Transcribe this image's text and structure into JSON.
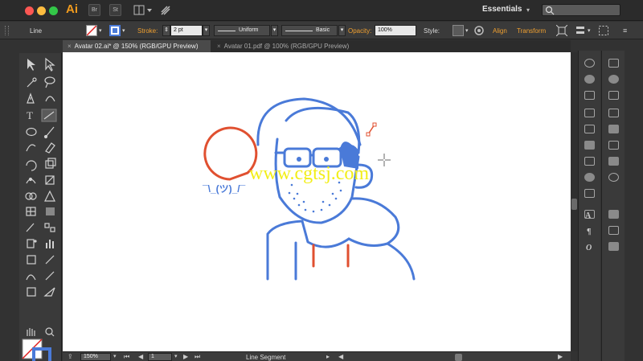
{
  "app": {
    "logo": "Ai",
    "workspace": "Essentials"
  },
  "titlebar_buttons": [
    "Br",
    "St"
  ],
  "control": {
    "selection": "Line",
    "stroke_label": "Stroke:",
    "stroke_weight": "2 pt",
    "profile": "Uniform",
    "brush": "Basic",
    "opacity_label": "Opacity:",
    "opacity": "100%",
    "style_label": "Style:",
    "align": "Align",
    "transform": "Transform",
    "stroke_color": "#4a7ad8"
  },
  "tabs": [
    {
      "label": "Avatar 02.ai* @ 150% (RGB/GPU Preview)",
      "active": true
    },
    {
      "label": "Avatar 01.pdf @ 100% (RGB/GPU Preview)",
      "active": false
    }
  ],
  "canvas": {
    "speech_text": "¯\\_(ツ)_/¯",
    "watermark": "www.cgtsj.com",
    "colors": {
      "line": "#4a7ad8",
      "accent": "#e05030",
      "watermark": "#f2ee18"
    }
  },
  "status": {
    "zoom": "150%",
    "page": "1",
    "tool": "Line Segment"
  },
  "icons": [
    "selection-icon",
    "direct-selection-icon",
    "magic-wand-icon",
    "lasso-icon",
    "pen-icon",
    "curvature-icon",
    "type-icon",
    "line-segment-icon",
    "ellipse-icon",
    "paintbrush-icon",
    "shaper-icon",
    "eraser-icon",
    "rotate-icon",
    "scale-icon",
    "width-icon",
    "free-transform-icon",
    "shape-builder-icon",
    "perspective-icon",
    "mesh-icon",
    "gradient-icon",
    "eyedropper-icon",
    "blend-icon",
    "symbol-sprayer-icon",
    "graph-icon",
    "artboard-icon",
    "slice-icon",
    "hand-icon",
    "zoom-icon"
  ]
}
